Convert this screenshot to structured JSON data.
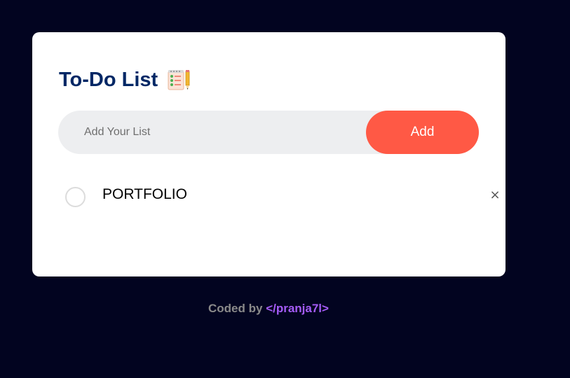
{
  "app": {
    "title": "To-Do List",
    "title_icon": "checklist-notepad-icon"
  },
  "input": {
    "placeholder": "Add Your List",
    "value": ""
  },
  "add_button": {
    "label": "Add",
    "color": "#ff5945"
  },
  "tasks": [
    {
      "text": "PORTFOLIO",
      "checked": false,
      "delete_symbol": "×",
      "delete_icon": "close-icon"
    }
  ],
  "footer": {
    "prefix": "Coded by ",
    "author": "</pranja7l>"
  },
  "colors": {
    "background": "#020420",
    "card": "#ffffff",
    "title": "#002765",
    "accent": "#ff5945",
    "author_link": "#a55cf7"
  }
}
